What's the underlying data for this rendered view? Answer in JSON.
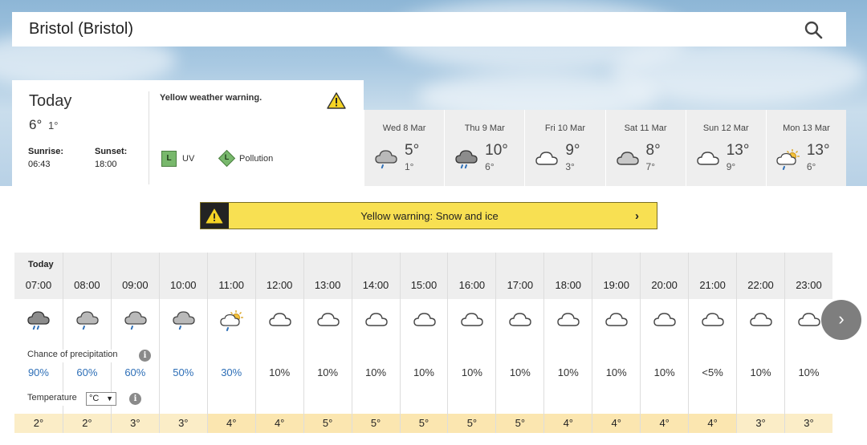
{
  "search": {
    "location": "Bristol (Bristol)"
  },
  "today": {
    "title": "Today",
    "high": "6°",
    "low": "1°",
    "sunrise_label": "Sunrise:",
    "sunrise": "06:43",
    "sunset_label": "Sunset:",
    "sunset": "18:00",
    "warning_text": "Yellow weather warning.",
    "uv_level": "L",
    "uv_label": "UV",
    "pollution_level": "L",
    "pollution_label": "Pollution"
  },
  "days": [
    {
      "name": "Wed 8 Mar",
      "high": "5°",
      "low": "1°",
      "icon": "cloud-rain-icon"
    },
    {
      "name": "Thu 9 Mar",
      "high": "10°",
      "low": "6°",
      "icon": "dark-cloud-rain-icon"
    },
    {
      "name": "Fri 10 Mar",
      "high": "9°",
      "low": "3°",
      "icon": "cloud-icon"
    },
    {
      "name": "Sat 11 Mar",
      "high": "8°",
      "low": "7°",
      "icon": "grey-cloud-icon"
    },
    {
      "name": "Sun 12 Mar",
      "high": "13°",
      "low": "9°",
      "icon": "cloud-icon"
    },
    {
      "name": "Mon 13 Mar",
      "high": "13°",
      "low": "6°",
      "icon": "sun-cloud-rain-icon"
    }
  ],
  "warning_banner": {
    "text": "Yellow warning: Snow and ice",
    "chevron": "›"
  },
  "hourly": {
    "day_label": "Today",
    "precip_label": "Chance of precipitation",
    "temp_label": "Temperature",
    "unit": "°C",
    "hours": [
      {
        "time": "07:00",
        "precip": "90%",
        "temp": "2°",
        "icon": "dark-cloud-rain-icon"
      },
      {
        "time": "08:00",
        "precip": "60%",
        "temp": "2°",
        "icon": "cloud-rain-icon"
      },
      {
        "time": "09:00",
        "precip": "60%",
        "temp": "3°",
        "icon": "cloud-rain-icon"
      },
      {
        "time": "10:00",
        "precip": "50%",
        "temp": "3°",
        "icon": "cloud-rain-icon"
      },
      {
        "time": "11:00",
        "precip": "30%",
        "temp": "4°",
        "icon": "sun-cloud-rain-icon"
      },
      {
        "time": "12:00",
        "precip": "10%",
        "temp": "4°",
        "icon": "cloud-icon"
      },
      {
        "time": "13:00",
        "precip": "10%",
        "temp": "5°",
        "icon": "cloud-icon"
      },
      {
        "time": "14:00",
        "precip": "10%",
        "temp": "5°",
        "icon": "cloud-icon"
      },
      {
        "time": "15:00",
        "precip": "10%",
        "temp": "5°",
        "icon": "cloud-icon"
      },
      {
        "time": "16:00",
        "precip": "10%",
        "temp": "5°",
        "icon": "cloud-icon"
      },
      {
        "time": "17:00",
        "precip": "10%",
        "temp": "5°",
        "icon": "cloud-icon"
      },
      {
        "time": "18:00",
        "precip": "10%",
        "temp": "4°",
        "icon": "cloud-icon"
      },
      {
        "time": "19:00",
        "precip": "10%",
        "temp": "4°",
        "icon": "cloud-icon"
      },
      {
        "time": "20:00",
        "precip": "10%",
        "temp": "4°",
        "icon": "cloud-icon"
      },
      {
        "time": "21:00",
        "precip": "<5%",
        "temp": "4°",
        "icon": "cloud-icon"
      },
      {
        "time": "22:00",
        "precip": "10%",
        "temp": "3°",
        "icon": "cloud-icon"
      },
      {
        "time": "23:00",
        "precip": "10%",
        "temp": "3°",
        "icon": "cloud-icon"
      }
    ]
  },
  "next_button": "›",
  "colors": {
    "warning_yellow": "#f8e052",
    "precip_blue": "#2e6fb7",
    "uv_green": "#78b86c",
    "temp_band": "#fbedc7"
  }
}
